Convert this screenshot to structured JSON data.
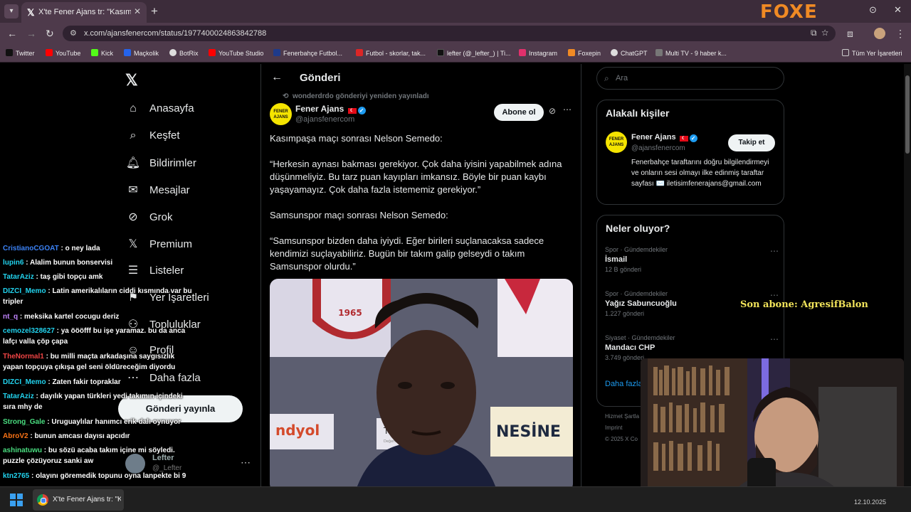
{
  "browser": {
    "tab_title": "X'te Fener Ajans tr: \"Kasımpaşa",
    "url": "x.com/ajansfenercom/status/1977400024863842788",
    "brand_overlay": "FOXE",
    "bookmarks": [
      "Twitter",
      "YouTube",
      "Kick",
      "Maçkolik",
      "BotRix",
      "YouTube Studio",
      "Fenerbahçe Futbol...",
      "Futbol - skorlar, tak...",
      "lefter (@_lefter_) | Ti...",
      "Instagram",
      "Foxepin",
      "ChatGPT",
      "Multi TV - 9 haber k...",
      "Tüm Yer İşaretleri"
    ]
  },
  "sidebar": {
    "items": [
      "Anasayfa",
      "Keşfet",
      "Bildirimler",
      "Mesajlar",
      "Grok",
      "Premium",
      "Listeler",
      "Yer İşaretleri",
      "Topluluklar",
      "Profil",
      "Daha fazla"
    ],
    "post_button": "Gönderi yayınla",
    "user_name": "Lefter",
    "user_handle": "@_Lefter"
  },
  "header": {
    "title": "Gönderi"
  },
  "tweet": {
    "reposted_by": "wonderdrdo gönderiyi yeniden yayınladı",
    "author_name": "Fener Ajans",
    "author_handle": "@ajansfenercom",
    "avatar_text": "FENER AJANS",
    "subscribe_label": "Abone ol",
    "paragraphs": [
      "Kasımpaşa maçı sonrası Nelson Semedo:",
      "“Herkesin aynası bakması gerekiyor. Çok daha iyisini yapabilmek adına düşünmeliyiz. Bu tarz puan kayıpları imkansız. Böyle bir puan kaybı yaşayamayız. Çok daha fazla istememiz gerekiyor.”",
      "Samsunspor maçı sonrası Nelson Semedo:",
      "“Samsunspor bizden daha iyiydi. Eğer birileri suçlanacaksa sadece kendimizi suçlayabiliriz. Bugün bir takım galip gelseydi o takım Samsunspor olurdu.”"
    ],
    "media_texts": {
      "year": "1965",
      "sponsor_left": "ndyol",
      "sponsor_mid": "Türk T",
      "sponsor_mid_small": "Değerli Hisse",
      "sponsor_right": "NESİNE"
    }
  },
  "right": {
    "search_placeholder": "Ara",
    "related_title": "Alakalı kişiler",
    "related_person": {
      "name": "Fener Ajans",
      "handle": "@ajansfenercom",
      "follow_label": "Takip et",
      "bio": "Fenerbahçe taraftarını doğru bilgilendirmeyi ve onların sesi olmayı ilke edinmiş taraftar sayfası ✉️ iletisimfenerajans@gmail.com"
    },
    "trends_title": "Neler oluyor?",
    "trends": [
      {
        "category": "Spor · Gündemdekiler",
        "name": "İsmail",
        "count": "12 B gönderi"
      },
      {
        "category": "Spor · Gündemdekiler",
        "name": "Yağız Sabuncuoğlu",
        "count": "1.227 gönderi"
      },
      {
        "category": "Siyaset · Gündemdekiler",
        "name": "Mandacı CHP",
        "count": "3.749 gönderi"
      }
    ],
    "show_more": "Daha fazla",
    "footer": [
      "Hizmet Şartla",
      "Imprint",
      "© 2025 X Co"
    ]
  },
  "chat": [
    {
      "user": "CristianoCGOAT",
      "text": "o ney lada",
      "color": "#3b82f6"
    },
    {
      "user": "lupin6",
      "text": "Alalim bunun bonservisi",
      "color": "#22d3ee"
    },
    {
      "user": "TatarAziz",
      "text": "taş gibi topçu amk",
      "color": "#22d3ee"
    },
    {
      "user": "DIZCI_Memo",
      "text": "Latin amerikalıların ciddi kısmında var bu tripler",
      "color": "#22d3ee"
    },
    {
      "user": "nt_q",
      "text": "meksika kartel cocugu deriz",
      "color": "#c084fc"
    },
    {
      "user": "cemozel328627",
      "text": "ya öööfff bu işe yaramaz. bu da anca lafçı valla çöp çapa",
      "color": "#22d3ee"
    },
    {
      "user": "TheNormal1",
      "text": "bu milli maçta arkadaşına saygısızlık yapan topçuya çıkışa gel seni öldüreceğim diyordu",
      "color": "#ef4444"
    },
    {
      "user": "DIZCI_Memo",
      "text": "Zaten fakir topraklar",
      "color": "#22d3ee"
    },
    {
      "user": "TatarAziz",
      "text": "dayılık yapan türkleri yedi takımın içindeki sıra mhy de",
      "color": "#22d3ee"
    },
    {
      "user": "Strong_Gale",
      "text": "Uruguaylılar hanımcı erik dalı oynuyor",
      "color": "#4ade80"
    },
    {
      "user": "AbroV2",
      "text": "bunun amcası dayısı apcıdır",
      "color": "#f97316"
    },
    {
      "user": "ashinatuwu",
      "text": "bu sözü acaba takım içine mi söyledi. puzzle çözüyoruz sanki aw",
      "color": "#4ade80"
    },
    {
      "user": "ktn2765",
      "text": "olayını göremedik topunu oyna lanpekte bi 9",
      "color": "#22d3ee"
    }
  ],
  "stream_overlay": {
    "last_sub": "Son abone: AgresifBalon"
  },
  "taskbar": {
    "app_label": "X'te Fener Ajans tr: \"Kas",
    "clock": "12.10.2025"
  }
}
